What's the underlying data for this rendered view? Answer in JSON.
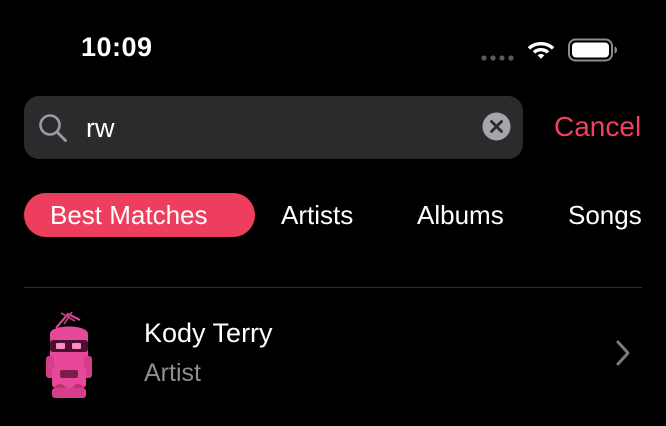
{
  "status_bar": {
    "time": "10:09"
  },
  "search": {
    "value": "rw",
    "cancel_label": "Cancel"
  },
  "scope_tabs": [
    {
      "label": "Best Matches",
      "active": true
    },
    {
      "label": "Artists",
      "active": false
    },
    {
      "label": "Albums",
      "active": false
    },
    {
      "label": "Songs",
      "active": false
    }
  ],
  "results": [
    {
      "title": "Kody Terry",
      "subtitle": "Artist",
      "image": "pink-robot-avatar"
    }
  ],
  "icons": {
    "search": "magnifying-glass",
    "clear": "x-circle",
    "row_disclosure": "chevron-right",
    "wifi": "wifi",
    "battery": "battery-full",
    "signal": "cellular-signal"
  },
  "colors": {
    "background": "#000000",
    "accent": "#f43f5e",
    "active_tab": "#ee3e5d",
    "search_field": "#2b2b2e",
    "secondary_text": "#8d8d93"
  }
}
